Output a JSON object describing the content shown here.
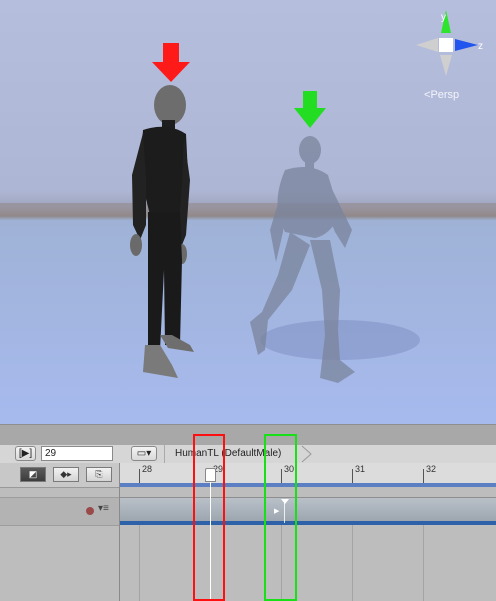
{
  "scene": {
    "projection_label": "Persp",
    "gizmo_axes": {
      "y_label": "y",
      "z_label": "z"
    },
    "colors": {
      "red_marker": "#ff1a1a",
      "green_marker": "#22dd22",
      "sky": "#b6bede",
      "ground": "#a7baee"
    },
    "icons": [
      "scene-gizmo-icon",
      "red-arrow-icon",
      "green-arrow-icon"
    ]
  },
  "animation": {
    "toolbar": {
      "play_label": "[▶]",
      "current_frame": "29",
      "clip_icon": "clip-menu-icon",
      "clip_name": "HumanTL (DefaultMale)"
    },
    "modes": [
      {
        "name": "dopesheet",
        "label": "◩"
      },
      {
        "name": "add-key",
        "label": "◆▸"
      },
      {
        "name": "add-event",
        "label": "⎘"
      }
    ],
    "ruler": {
      "ticks": [
        "28",
        "29",
        "30",
        "31",
        "32"
      ]
    },
    "current_frame_value": 29,
    "highlight_colors": {
      "current": "#ff1010",
      "next": "#18e018"
    }
  }
}
